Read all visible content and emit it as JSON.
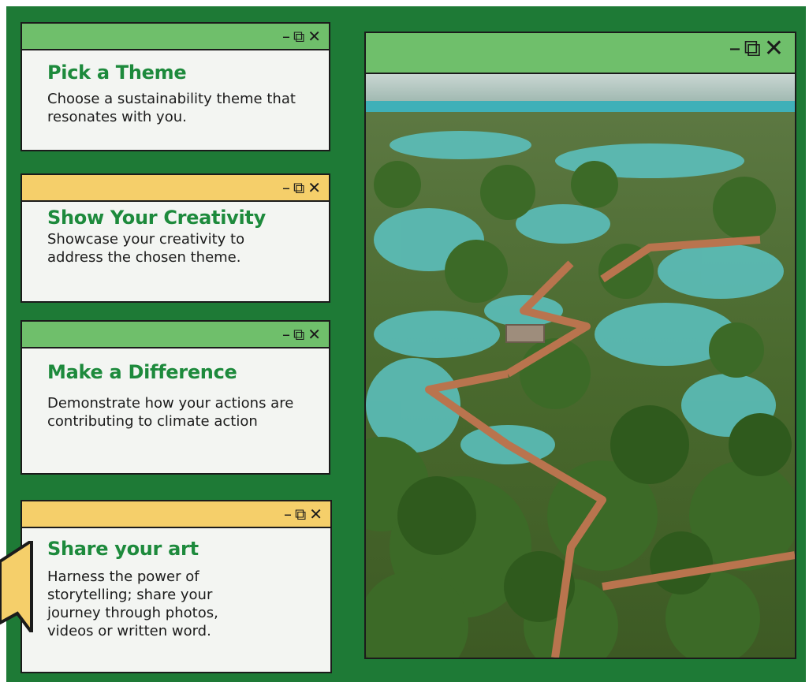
{
  "cards": [
    {
      "title": "Pick a Theme",
      "text": "Choose a sustainability theme that resonates with you.",
      "bar": "green"
    },
    {
      "title": "Show Your Creativity",
      "text": "Showcase your creativity to address the chosen theme.",
      "bar": "yellow"
    },
    {
      "title": "Make a Difference",
      "text": "Demonstrate how your actions  are contributing to climate action",
      "bar": "green"
    },
    {
      "title": "Share your art",
      "text": "Harness the power of storytelling; share your journey through photos, videos or written word.",
      "bar": "yellow"
    }
  ],
  "window_controls": {
    "minimize": "–",
    "restore": "⧉",
    "close": "✕"
  },
  "colors": {
    "background": "#1e7a36",
    "bar_green": "#6fbf6b",
    "bar_yellow": "#f5cf6a",
    "title_green": "#1d8a3c"
  },
  "photo": {
    "subject": "aerial view of mangrove forest with wooden boardwalk over water"
  }
}
